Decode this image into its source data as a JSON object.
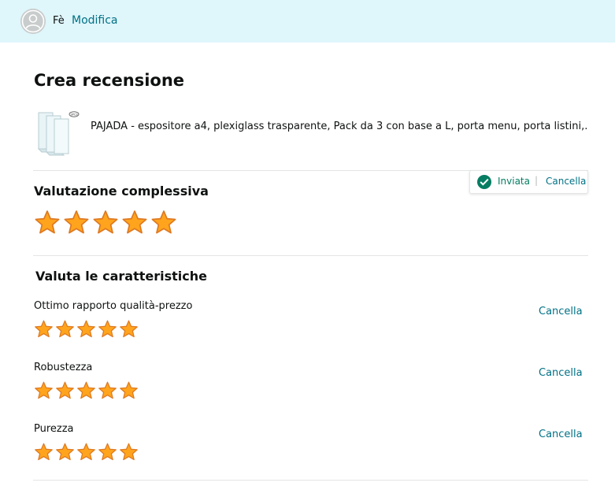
{
  "header": {
    "user_name": "Fè",
    "edit_label": "Modifica",
    "avatar_icon": "user-avatar-icon"
  },
  "page": {
    "title": "Crea recensione"
  },
  "product": {
    "title": "PAJADA - espositore a4, plexiglass trasparente, Pack da 3 con base a L, porta menu, porta listini,..."
  },
  "overall": {
    "label": "Valutazione complessiva",
    "rating": 5,
    "max": 5,
    "status_label": "Inviata",
    "cancel_label": "Cancella"
  },
  "features": {
    "label": "Valuta le caratteristiche",
    "items": [
      {
        "name": "Ottimo rapporto qualità-prezzo",
        "rating": 5,
        "max": 5,
        "cancel_label": "Cancella"
      },
      {
        "name": "Robustezza",
        "rating": 5,
        "max": 5,
        "cancel_label": "Cancella"
      },
      {
        "name": "Purezza",
        "rating": 5,
        "max": 5,
        "cancel_label": "Cancella"
      }
    ]
  },
  "colors": {
    "header_bg": "#dff6fb",
    "link": "#007185",
    "success": "#067d62",
    "star_fill": "#ffa41c",
    "star_stroke": "#de7921",
    "divider": "#e3e6e6"
  }
}
